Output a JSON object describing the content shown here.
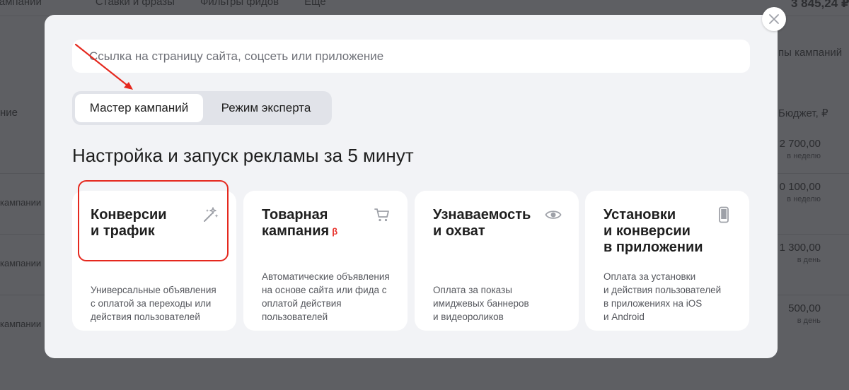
{
  "background": {
    "tabs": [
      "Кампании",
      "Ставки и фразы",
      "Фильтры фидов",
      "Ещё"
    ],
    "balance": "3 845,24 ₽",
    "right_header": "пы кампаний",
    "left_column_header": "ние",
    "budget_header": "Бюджет, ₽",
    "left_rows": [
      "кампании",
      "кампании",
      "кампании"
    ],
    "budgets": [
      {
        "value": "2 700,00",
        "period": "в неделю"
      },
      {
        "value": "0 100,00",
        "period": "в неделю"
      },
      {
        "value": "1 300,00",
        "period": "в день"
      },
      {
        "value": "500,00",
        "period": "в день"
      }
    ]
  },
  "modal": {
    "url_placeholder": "Ссылка на страницу сайта, соцсеть или приложение",
    "mode_toggle": {
      "active_label": "Мастер кампаний",
      "inactive_label": "Режим эксперта"
    },
    "headline": "Настройка и запуск рекламы за 5 минут",
    "cards": [
      {
        "title_lines": [
          "Конверсии",
          "и трафик"
        ],
        "icon": "magic-wand-icon",
        "desc_lines": [
          "Универсальные объявления",
          "с оплатой за переходы или",
          "действия пользователей"
        ]
      },
      {
        "title_lines": [
          "Товарная",
          "кампания"
        ],
        "beta": "β",
        "icon": "cart-icon",
        "desc_lines": [
          "Автоматические объявления",
          "на основе сайта или фида с",
          "оплатой действия",
          "пользователей"
        ]
      },
      {
        "title_lines": [
          "Узнаваемость",
          "и охват"
        ],
        "icon": "eye-icon",
        "desc_lines": [
          "Оплата за показы",
          "имиджевых баннеров",
          "и видеороликов"
        ]
      },
      {
        "title_lines": [
          "Установки",
          "и конверсии",
          "в приложении"
        ],
        "icon": "phone-icon",
        "desc_lines": [
          "Оплата за установки",
          "и действия пользователей",
          "в приложениях на iOS",
          "и Android"
        ]
      }
    ]
  },
  "colors": {
    "overlay_bg": "#5e5f63",
    "modal_bg": "#f2f3f6",
    "annotation_red": "#e5281e",
    "beta_red": "#e8352f",
    "icon_gray": "#9ea1a8"
  }
}
